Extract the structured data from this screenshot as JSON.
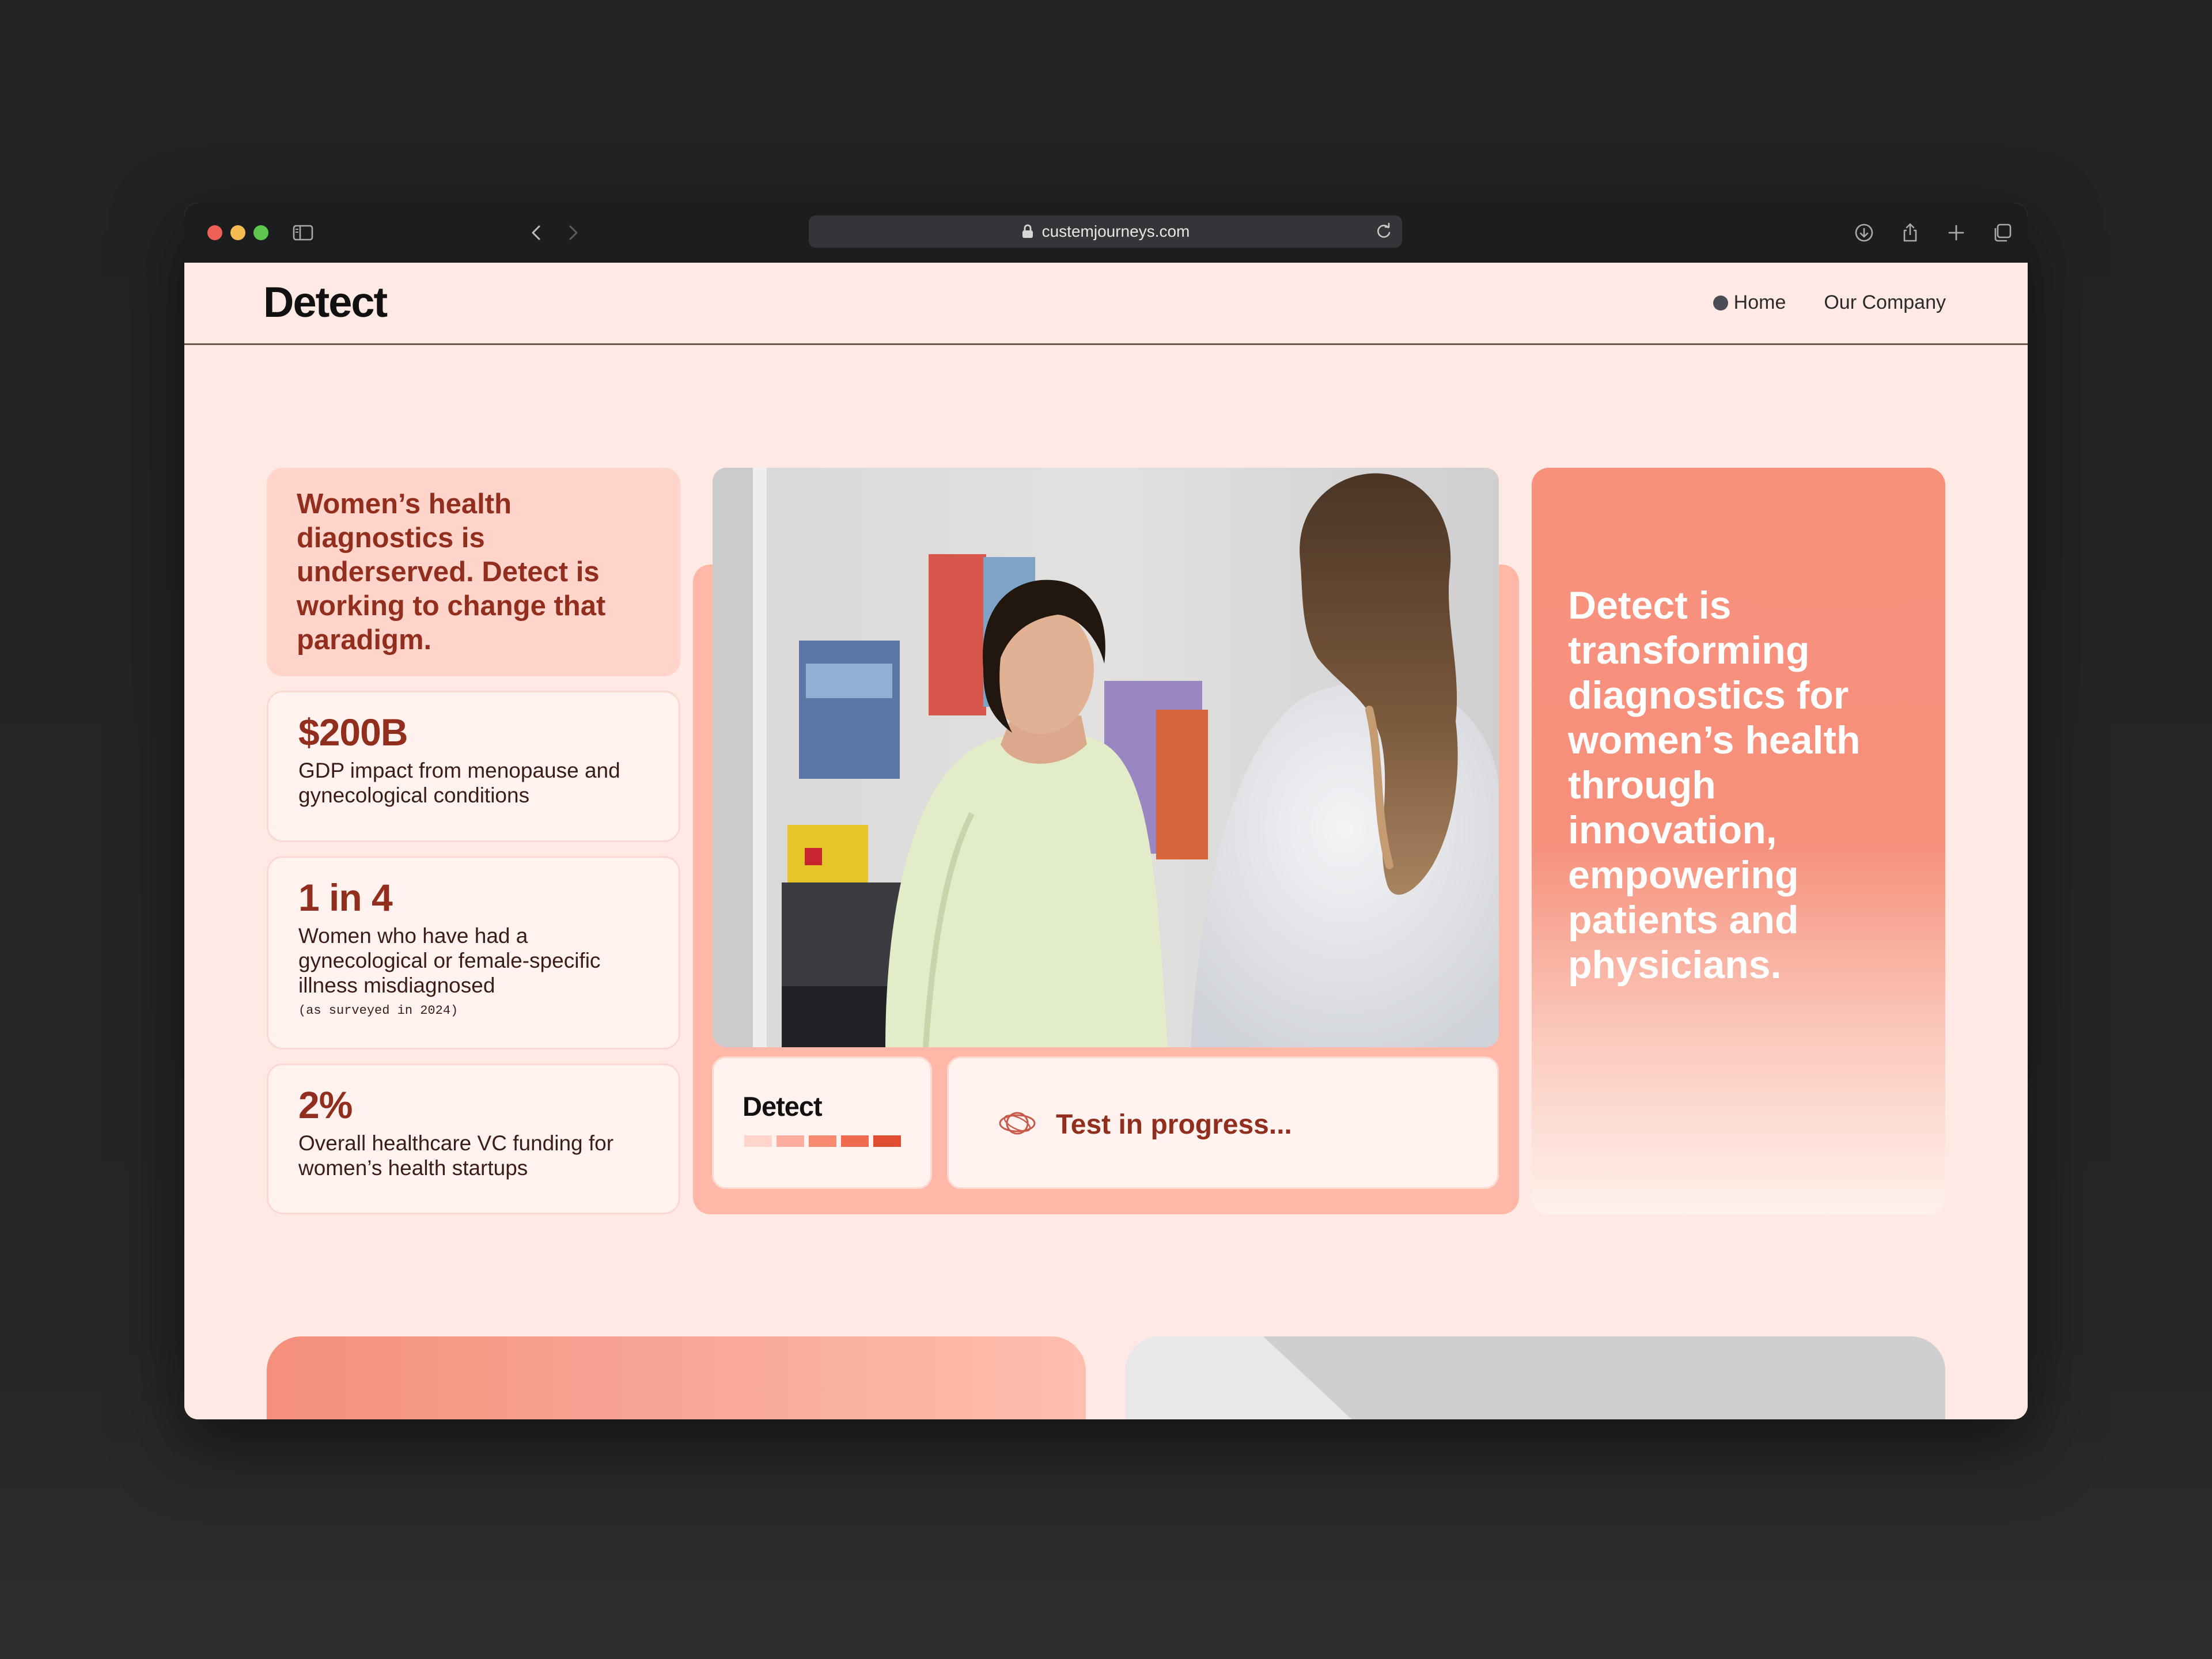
{
  "browser": {
    "url": "custemjourneys.com",
    "traffic_lights": {
      "close": "#ed5f57",
      "minimize": "#f5bd4f",
      "zoom": "#5fc64e"
    }
  },
  "site": {
    "logo": "Detect",
    "nav": [
      {
        "label": "Home",
        "active": true
      },
      {
        "label": "Our Company",
        "active": false
      }
    ]
  },
  "intro": {
    "text": "Women’s health diagnostics is underserved. Detect is working to change that paradigm."
  },
  "stats": [
    {
      "value": "$200B",
      "label": "GDP impact from menopause and gynecological conditions",
      "note": ""
    },
    {
      "value": "1 in 4",
      "label": "Women who have had a gynecological or female-specific illness misdiagnosed",
      "note": "(as surveyed in 2024)"
    },
    {
      "value": "2%",
      "label": "Overall healthcare VC funding for women’s health startups",
      "note": ""
    }
  ],
  "device": {
    "logo": "Detect",
    "bar_colors": [
      "#ffd4cb",
      "#fcad9d",
      "#f88a72",
      "#ef6a4e",
      "#e04e31"
    ]
  },
  "progress": {
    "label": "Test in progress..."
  },
  "mission": {
    "text": "Detect is transforming diagnostics for women’s health through innovation, empowering patients and physicians."
  },
  "colors": {
    "brand_dark": "#922e1d",
    "accent": "#f6907b",
    "page_bg": "#ffe9e4",
    "card_bg": "#fff2ef"
  }
}
